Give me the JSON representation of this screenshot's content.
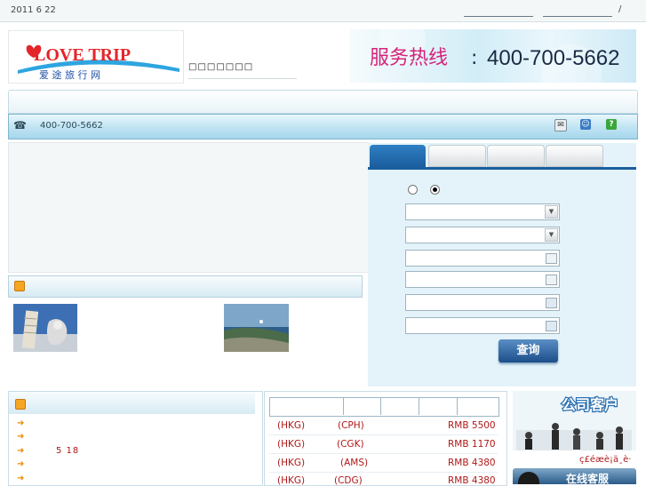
{
  "header": {
    "date": "2011 6 22",
    "slash": "/"
  },
  "logo": {
    "brand": "LOVE TRIP",
    "tagline": "爱 途 旅 行 网"
  },
  "site_name_box": "□□□□□□□",
  "hotline": {
    "label": "服务热线",
    "colon": ":",
    "number": "400-700-5662"
  },
  "phone_bar": {
    "icon": "☎",
    "number": "400-700-5662"
  },
  "search": {
    "button_label": "查询"
  },
  "news": {
    "date": "5 18"
  },
  "fares": {
    "rows": [
      {
        "from": "(HKG)",
        "to": "(CPH)",
        "price": "RMB 5500"
      },
      {
        "from": "(HKG)",
        "to": "(CGK)",
        "price": "RMB 1170"
      },
      {
        "from": "(HKG)",
        "to": "(AMS)",
        "price": "RMB 4380"
      },
      {
        "from": "(HKG)",
        "to": "(CDG)",
        "price": "RMB 4380"
      }
    ]
  },
  "sidebar": {
    "corp_banner": "公司客户",
    "garbled": "ç£éæè¡ä¸è·",
    "online_banner": "在线客服"
  },
  "colors": {
    "accent_blue": "#1b5e9e",
    "fare_red": "#b01818",
    "hotline_magenta": "#d4237a",
    "logo_red": "#e4252a",
    "logo_blue": "#1f4fa6",
    "panel_bg": "#e3f3f9"
  },
  "icons": [
    "phone-icon",
    "email-icon",
    "user-icon",
    "help-icon",
    "calendar-icon",
    "dropdown-icon",
    "arrow-icon",
    "section-icon"
  ]
}
